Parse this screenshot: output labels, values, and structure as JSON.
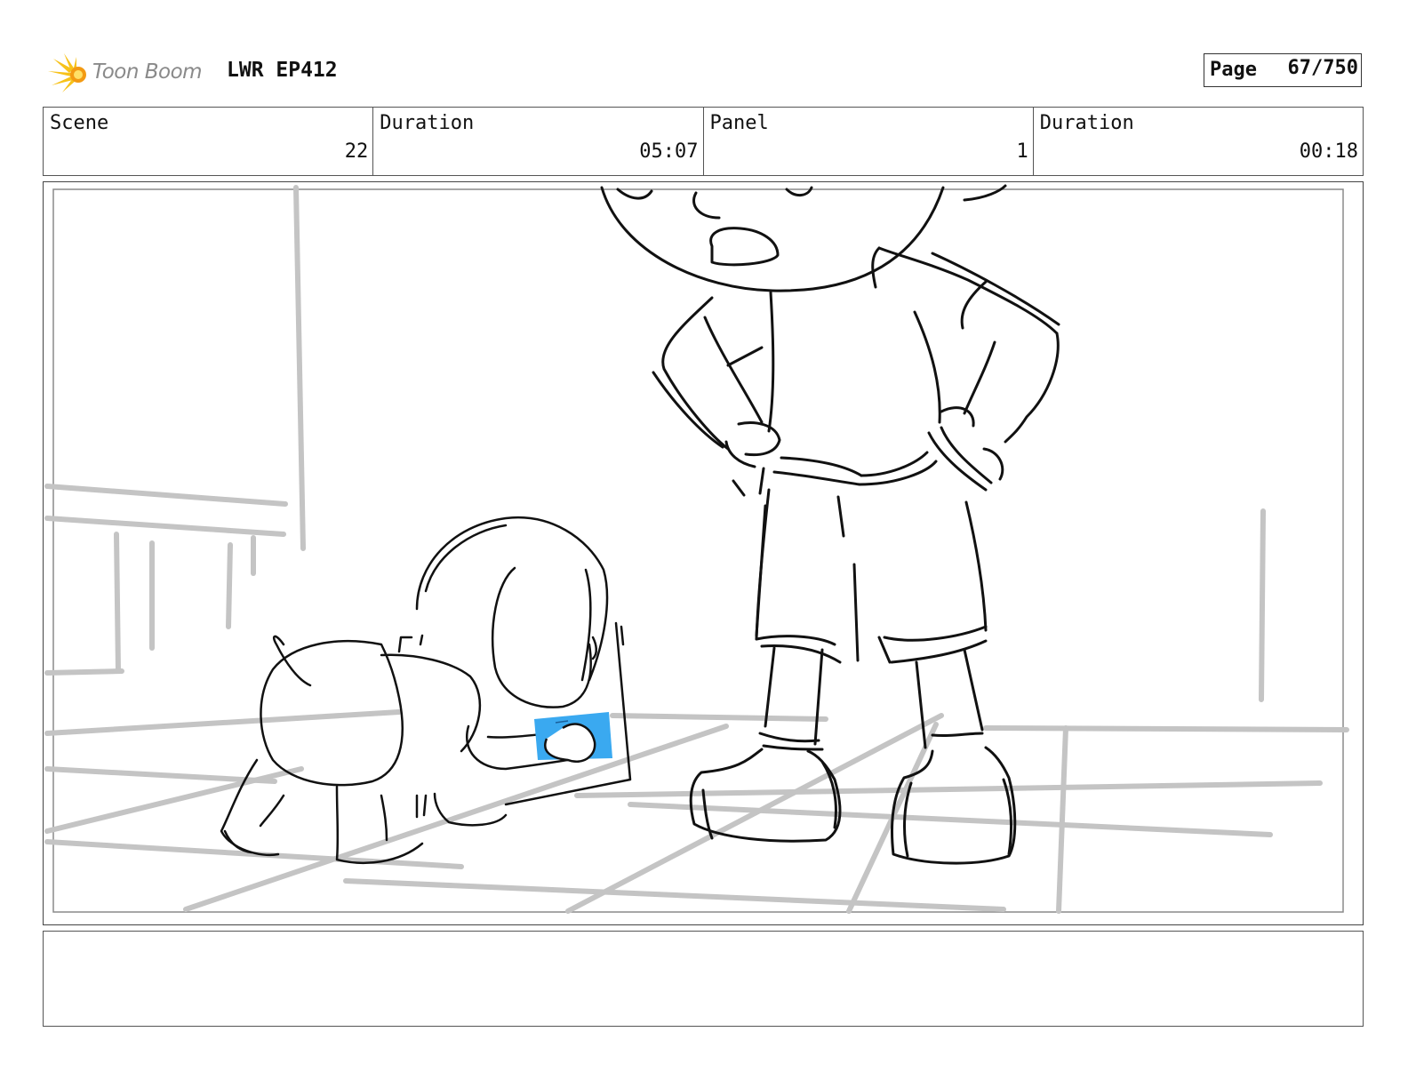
{
  "header": {
    "logo_text": "Toon Boom",
    "project": "LWR EP412",
    "page_label": "Page",
    "page_value": "67/750"
  },
  "info": {
    "scene_label": "Scene",
    "scene_value": "22",
    "scene_duration_label": "Duration",
    "scene_duration_value": "05:07",
    "panel_label": "Panel",
    "panel_value": "1",
    "panel_duration_label": "Duration",
    "panel_duration_value": "00:18"
  },
  "panel": {
    "image": "storyboard-sketch",
    "highlight_color": "#3aa9f0"
  },
  "notes": {
    "text": ""
  }
}
